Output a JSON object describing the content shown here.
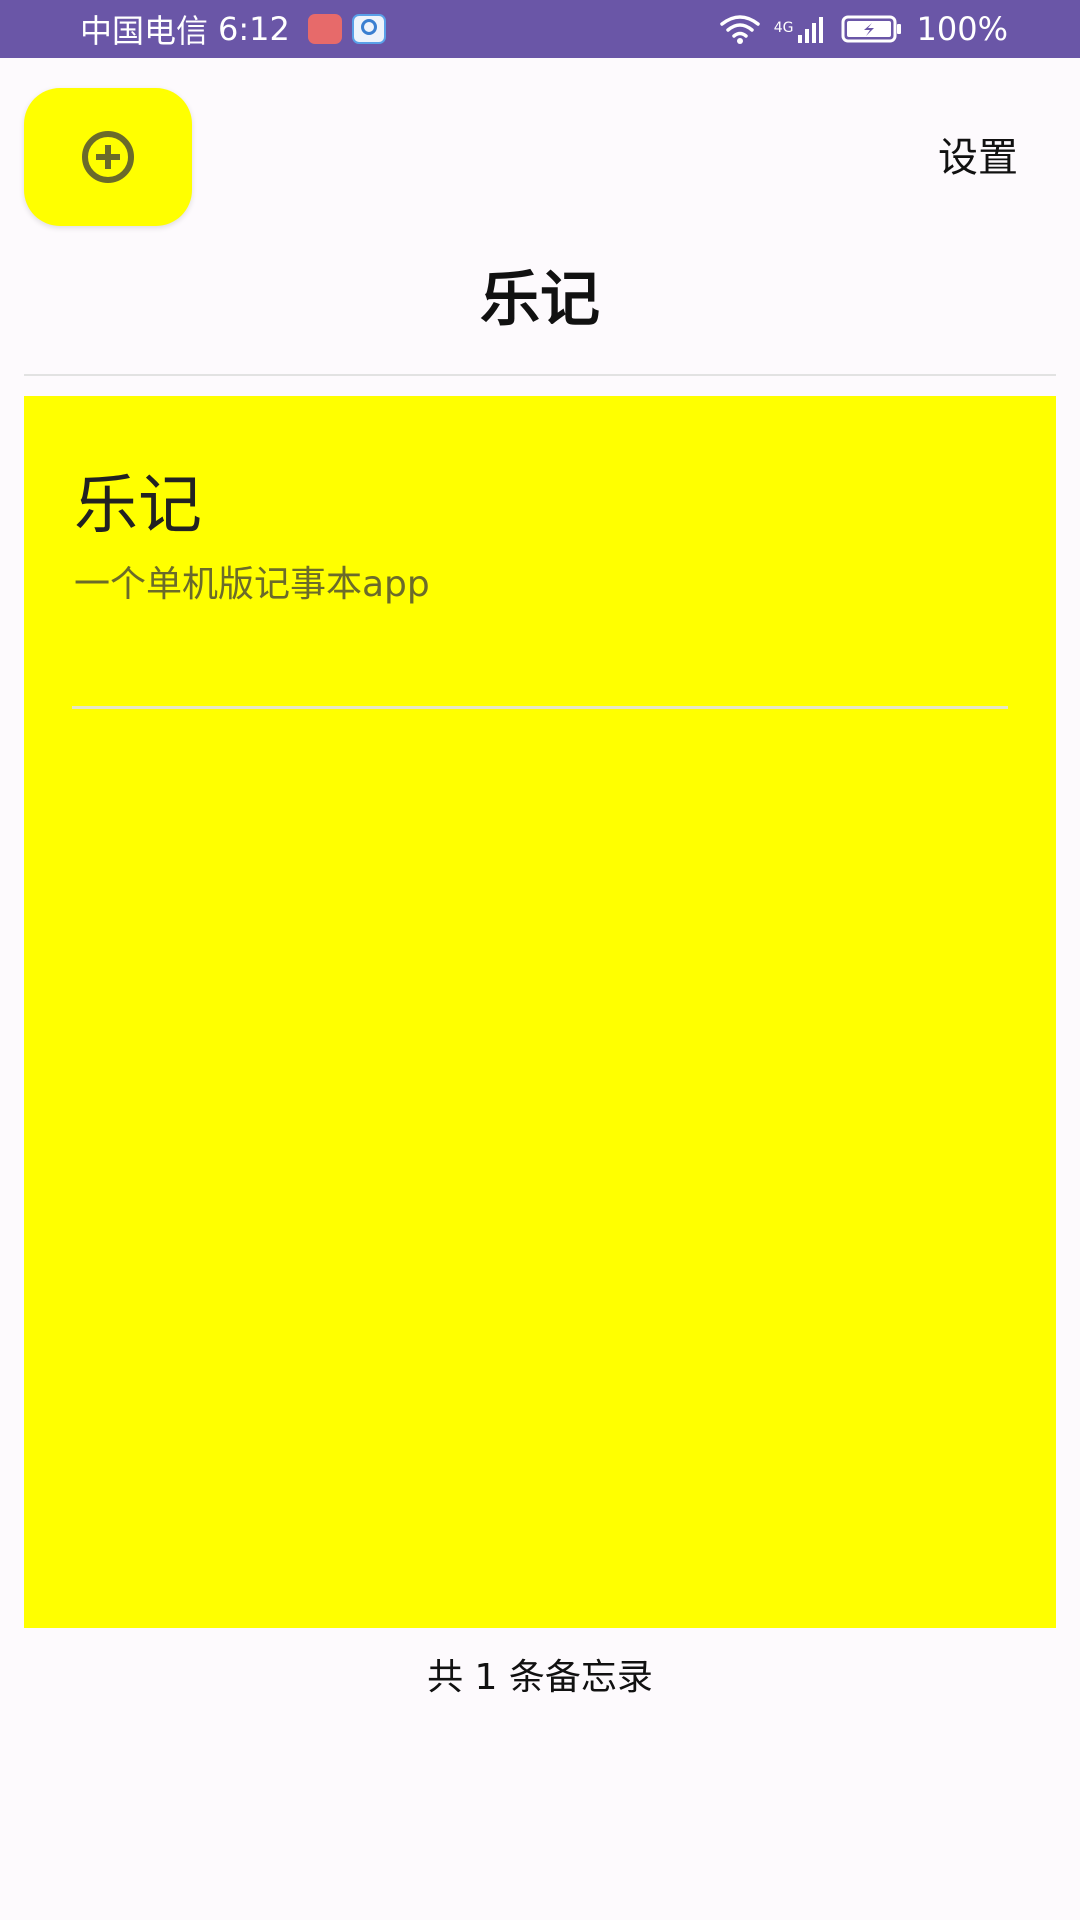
{
  "status_bar": {
    "carrier": "中国电信",
    "time": "6:12",
    "network": "4G",
    "battery": "100%",
    "background_color": "#6a56a7"
  },
  "header": {
    "add_icon": "add-circle-icon",
    "settings_label": "设置",
    "title": "乐记"
  },
  "notes": [
    {
      "title": "乐记",
      "content": "一个单机版记事本app",
      "color": "#ffff00"
    }
  ],
  "footer": {
    "count_text": "共 1 条备忘录"
  },
  "colors": {
    "accent": "#ffff00",
    "background": "#fdfafd"
  }
}
